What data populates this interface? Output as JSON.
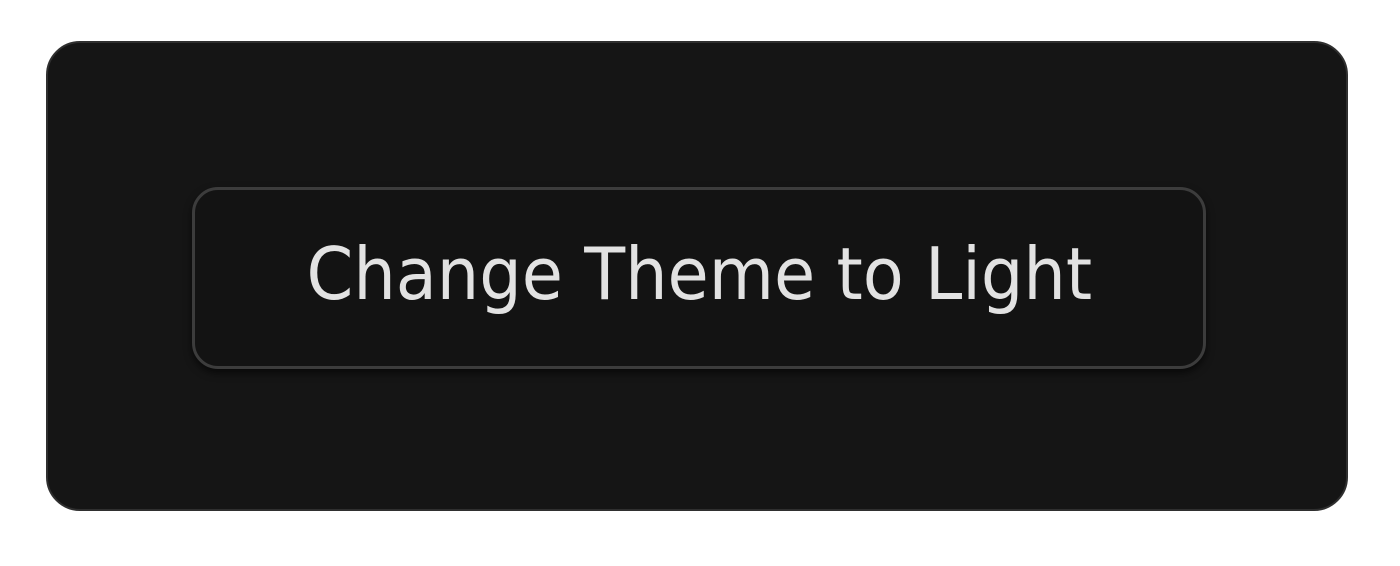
{
  "card": {
    "theme_button": {
      "label": "Change Theme to Light"
    }
  },
  "colors": {
    "page_background": "#ffffff",
    "card_background": "#151515",
    "card_border": "#2f2f2f",
    "button_background": "#131313",
    "button_border": "#3c3c3c",
    "button_text": "#e2e2e2"
  }
}
